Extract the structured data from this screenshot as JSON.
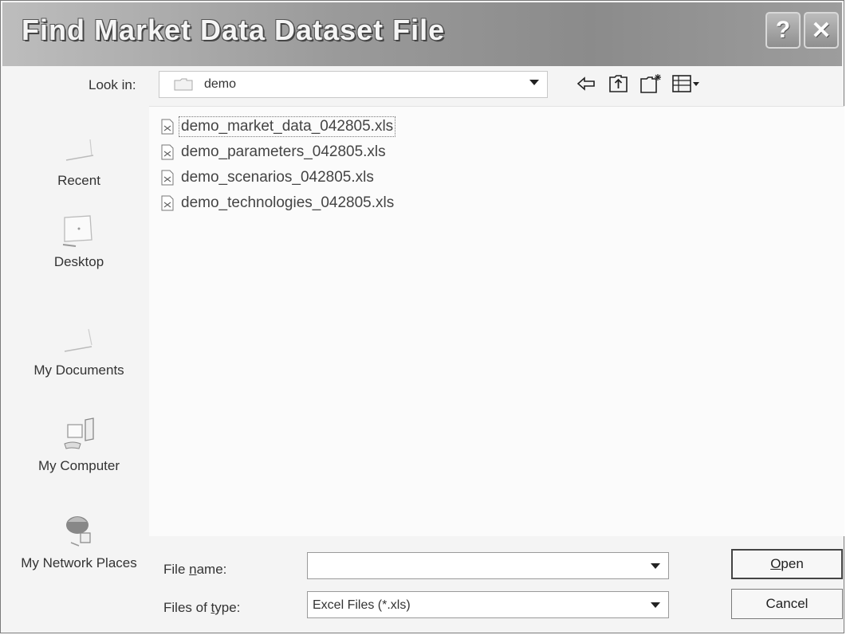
{
  "window": {
    "title": "Find Market Data Dataset File",
    "help_glyph": "?",
    "close_glyph": "✕"
  },
  "lookin": {
    "label": "Look in:",
    "value": "demo"
  },
  "toolbar": {
    "icons": [
      "back-icon",
      "up-one-level-icon",
      "new-folder-icon",
      "view-menu-icon"
    ]
  },
  "places": [
    {
      "label": "Recent",
      "icon": "recent-icon"
    },
    {
      "label": "Desktop",
      "icon": "desktop-icon"
    },
    {
      "label": "My Documents",
      "icon": "my-documents-icon"
    },
    {
      "label": "My Computer",
      "icon": "my-computer-icon"
    },
    {
      "label": "My Network Places",
      "icon": "network-places-icon"
    }
  ],
  "files": [
    {
      "name": "demo_market_data_042805.xls",
      "selected": true
    },
    {
      "name": "demo_parameters_042805.xls",
      "selected": false
    },
    {
      "name": "demo_scenarios_042805.xls",
      "selected": false
    },
    {
      "name": "demo_technologies_042805.xls",
      "selected": false
    }
  ],
  "filename": {
    "label_pre": "File ",
    "label_accel": "n",
    "label_post": "ame:",
    "value": ""
  },
  "filetype": {
    "label_pre": "Files of ",
    "label_accel": "t",
    "label_post": "ype:",
    "value": "Excel Files (*.xls)"
  },
  "buttons": {
    "open_accel": "O",
    "open_rest": "pen",
    "cancel": "Cancel"
  }
}
